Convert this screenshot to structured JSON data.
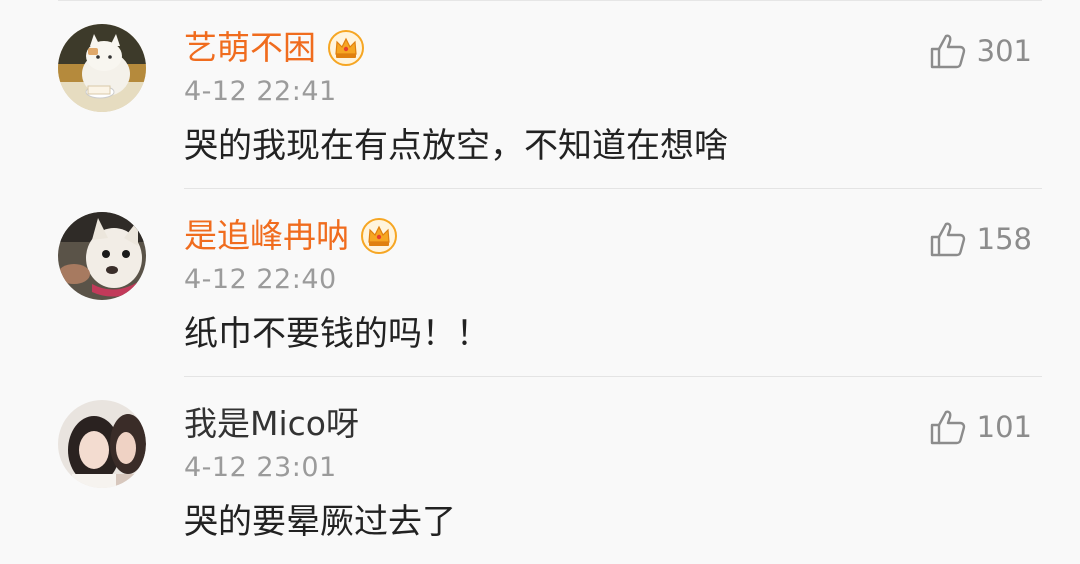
{
  "comments": [
    {
      "user": "艺萌不困",
      "vip": true,
      "time": "4-12 22:41",
      "text": "哭的我现在有点放空，不知道在想啥",
      "likes": "301",
      "avatar_icon": "cat-avatar"
    },
    {
      "user": "是追峰冉呐",
      "vip": true,
      "time": "4-12 22:40",
      "text": "纸巾不要钱的吗！！",
      "likes": "158",
      "avatar_icon": "dog-avatar"
    },
    {
      "user": "我是Mico呀",
      "vip": false,
      "time": "4-12 23:01",
      "text": "哭的要晕厥过去了",
      "likes": "101",
      "avatar_icon": "girls-avatar"
    }
  ],
  "colors": {
    "vip_name": "#f06c1e",
    "normal_name": "#333333",
    "meta": "#9b9b9b",
    "crown_gold": "#f6a623"
  }
}
